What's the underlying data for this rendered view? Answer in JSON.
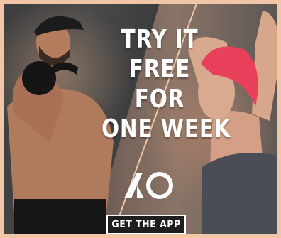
{
  "ad": {
    "headline_lines": [
      "TRY IT",
      "FREE",
      "FOR",
      "ONE WEEK"
    ],
    "logo_icon": "ao-logo-icon",
    "cta_label": "GET THE APP",
    "colors": {
      "border": "#f1c6a7",
      "headline": "#ffffff",
      "cta_background": "#1e1e1e",
      "cta_border": "#ffffff",
      "left_athlete_hair_cap": "#1c1c1c",
      "right_athlete_hair": "#e8405a",
      "top": "#3a3b3e"
    }
  }
}
